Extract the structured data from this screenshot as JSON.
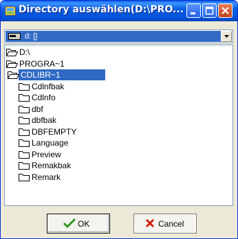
{
  "window": {
    "title": "Directory auswählen(D:\\PRO..."
  },
  "drive_select": {
    "value": "d: []"
  },
  "tree": [
    {
      "label": "D:\\",
      "icon": "folder-open-icon",
      "level": 0,
      "selected": false
    },
    {
      "label": "PROGRA~1",
      "icon": "folder-open-icon",
      "level": 0,
      "selected": false
    },
    {
      "label": "CDLIBR~1",
      "icon": "folder-open-icon",
      "level": 1,
      "selected": true
    },
    {
      "label": "Cdlnfbak",
      "icon": "folder-icon",
      "level": 2,
      "selected": false
    },
    {
      "label": "Cdlnfo",
      "icon": "folder-icon",
      "level": 2,
      "selected": false
    },
    {
      "label": "dbf",
      "icon": "folder-icon",
      "level": 2,
      "selected": false
    },
    {
      "label": "dbfbak",
      "icon": "folder-icon",
      "level": 2,
      "selected": false
    },
    {
      "label": "DBFEMPTY",
      "icon": "folder-icon",
      "level": 2,
      "selected": false
    },
    {
      "label": "Language",
      "icon": "folder-icon",
      "level": 2,
      "selected": false
    },
    {
      "label": "Preview",
      "icon": "folder-icon",
      "level": 2,
      "selected": false
    },
    {
      "label": "Remakbak",
      "icon": "folder-icon",
      "level": 2,
      "selected": false
    },
    {
      "label": "Remark",
      "icon": "folder-icon",
      "level": 2,
      "selected": false
    }
  ],
  "buttons": {
    "ok": "OK",
    "cancel": "Cancel"
  },
  "colors": {
    "titlebar": "#0a5fe6",
    "selection": "#316ac5",
    "dialog": "#ece9d8"
  }
}
